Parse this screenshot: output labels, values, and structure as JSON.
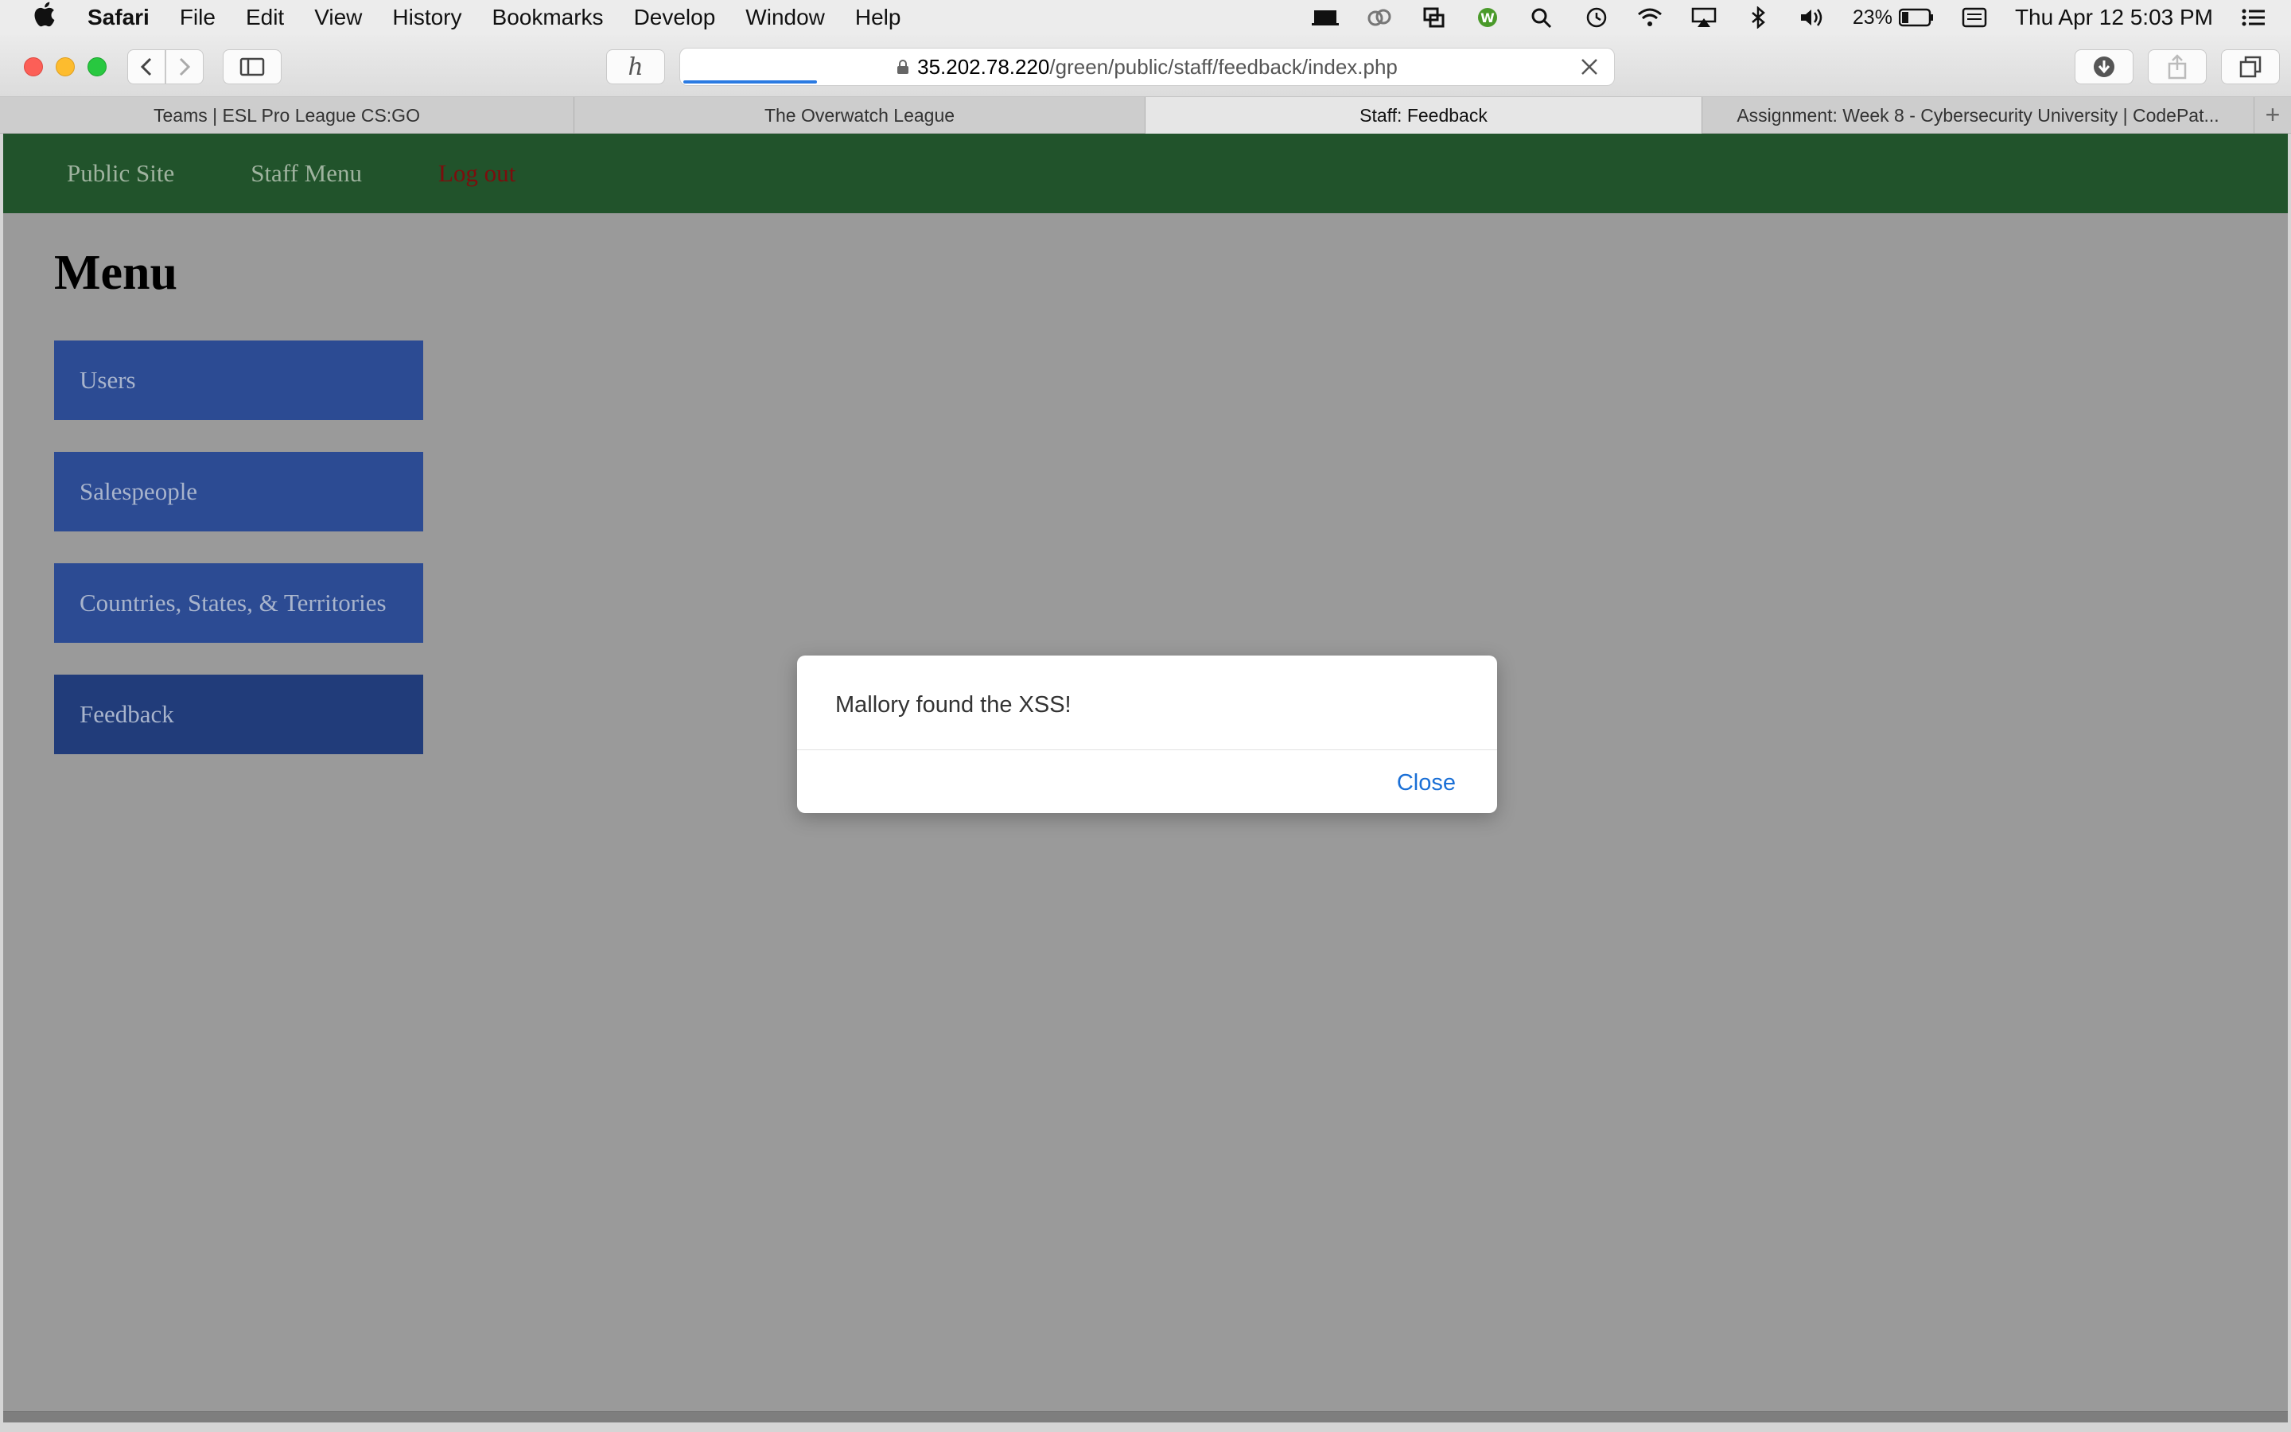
{
  "menubar": {
    "app": "Safari",
    "items": [
      "File",
      "Edit",
      "View",
      "History",
      "Bookmarks",
      "Develop",
      "Window",
      "Help"
    ],
    "battery": "23%",
    "clock": "Thu Apr 12  5:03 PM"
  },
  "toolbar": {
    "url_host": "35.202.78.220",
    "url_path": "/green/public/staff/feedback/index.php"
  },
  "tabs": [
    {
      "label": "Teams | ESL Pro League CS:GO",
      "active": false
    },
    {
      "label": "The Overwatch League",
      "active": false
    },
    {
      "label": "Staff: Feedback",
      "active": true
    },
    {
      "label": "Assignment: Week 8 - Cybersecurity University | CodePat...",
      "active": false
    }
  ],
  "site_nav": {
    "public_site": "Public Site",
    "staff_menu": "Staff Menu",
    "log_out": "Log out"
  },
  "page": {
    "title": "Menu",
    "menu_items": [
      "Users",
      "Salespeople",
      "Countries, States, & Territories",
      "Feedback"
    ]
  },
  "alert": {
    "message": "Mallory found the XSS!",
    "close_label": "Close"
  },
  "colors": {
    "nav_bg": "#21532b",
    "menu_item_bg": "#2c4b93",
    "logout_text": "#7c0d0d",
    "alert_link": "#1a6fd6"
  }
}
